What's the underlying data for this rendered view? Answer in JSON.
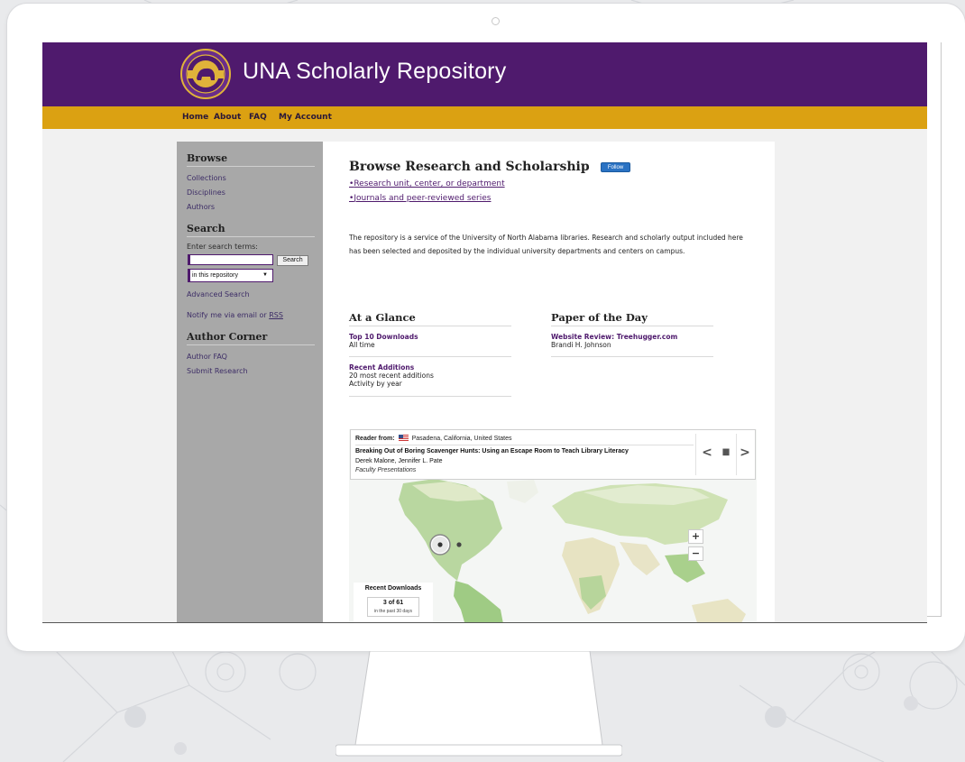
{
  "site": {
    "title": "UNA Scholarly Repository",
    "seal_text": "UNIVERSITY OF NORTH ALABAMA",
    "colors": {
      "header": "#4f1a6d",
      "navbar": "#dba112",
      "sidebar": "#a8a8a8",
      "follow": "#2a72c3"
    }
  },
  "nav": {
    "home": "Home",
    "about": "About",
    "faq": "FAQ",
    "account": "My Account"
  },
  "sidebar": {
    "browse_heading": "Browse",
    "browse_items": [
      "Collections",
      "Disciplines",
      "Authors"
    ],
    "search_heading": "Search",
    "search_label": "Enter search terms:",
    "search_value": "",
    "search_button": "Search",
    "scope_value": "in this repository",
    "advanced_search": "Advanced Search",
    "notify_text": "Notify me via email or",
    "rss": "RSS",
    "author_heading": "Author Corner",
    "author_items": [
      "Author FAQ",
      "Submit Research"
    ]
  },
  "main": {
    "title": "Browse Research and Scholarship",
    "follow": "Follow",
    "links": [
      "Research unit, center, or department",
      "Journals and peer-reviewed series"
    ],
    "intro": "The repository is a service of the University of North Alabama libraries. Research and scholarly output included here has been selected and deposited by the individual university departments and centers on campus.",
    "glance_heading": "At a Glance",
    "top10_link": "Top 10 Downloads",
    "top10_sub": "All time",
    "recent_link": "Recent Additions",
    "recent_sub1": "20 most recent additions",
    "recent_sub2": "Activity by year",
    "potd_heading": "Paper of the Day",
    "potd_link": "Website Review: Treehugger.com",
    "potd_author": "Brandi H. Johnson"
  },
  "map": {
    "reader_label": "Reader from:",
    "reader_location": "Pasadena, California, United States",
    "paper_title": "Breaking Out of Boring Scavenger Hunts: Using an Escape Room to Teach Library Literacy",
    "paper_authors": "Derek Malone, Jennifer L. Pate",
    "paper_collection": "Faculty Presentations",
    "prev_icon": "<",
    "pause_icon": "▮▮",
    "next_icon": ">",
    "zoom_in": "+",
    "zoom_out": "−",
    "downloads_title": "Recent Downloads",
    "downloads_count": "3 of 61",
    "downloads_sub": "in the past 30 days"
  }
}
